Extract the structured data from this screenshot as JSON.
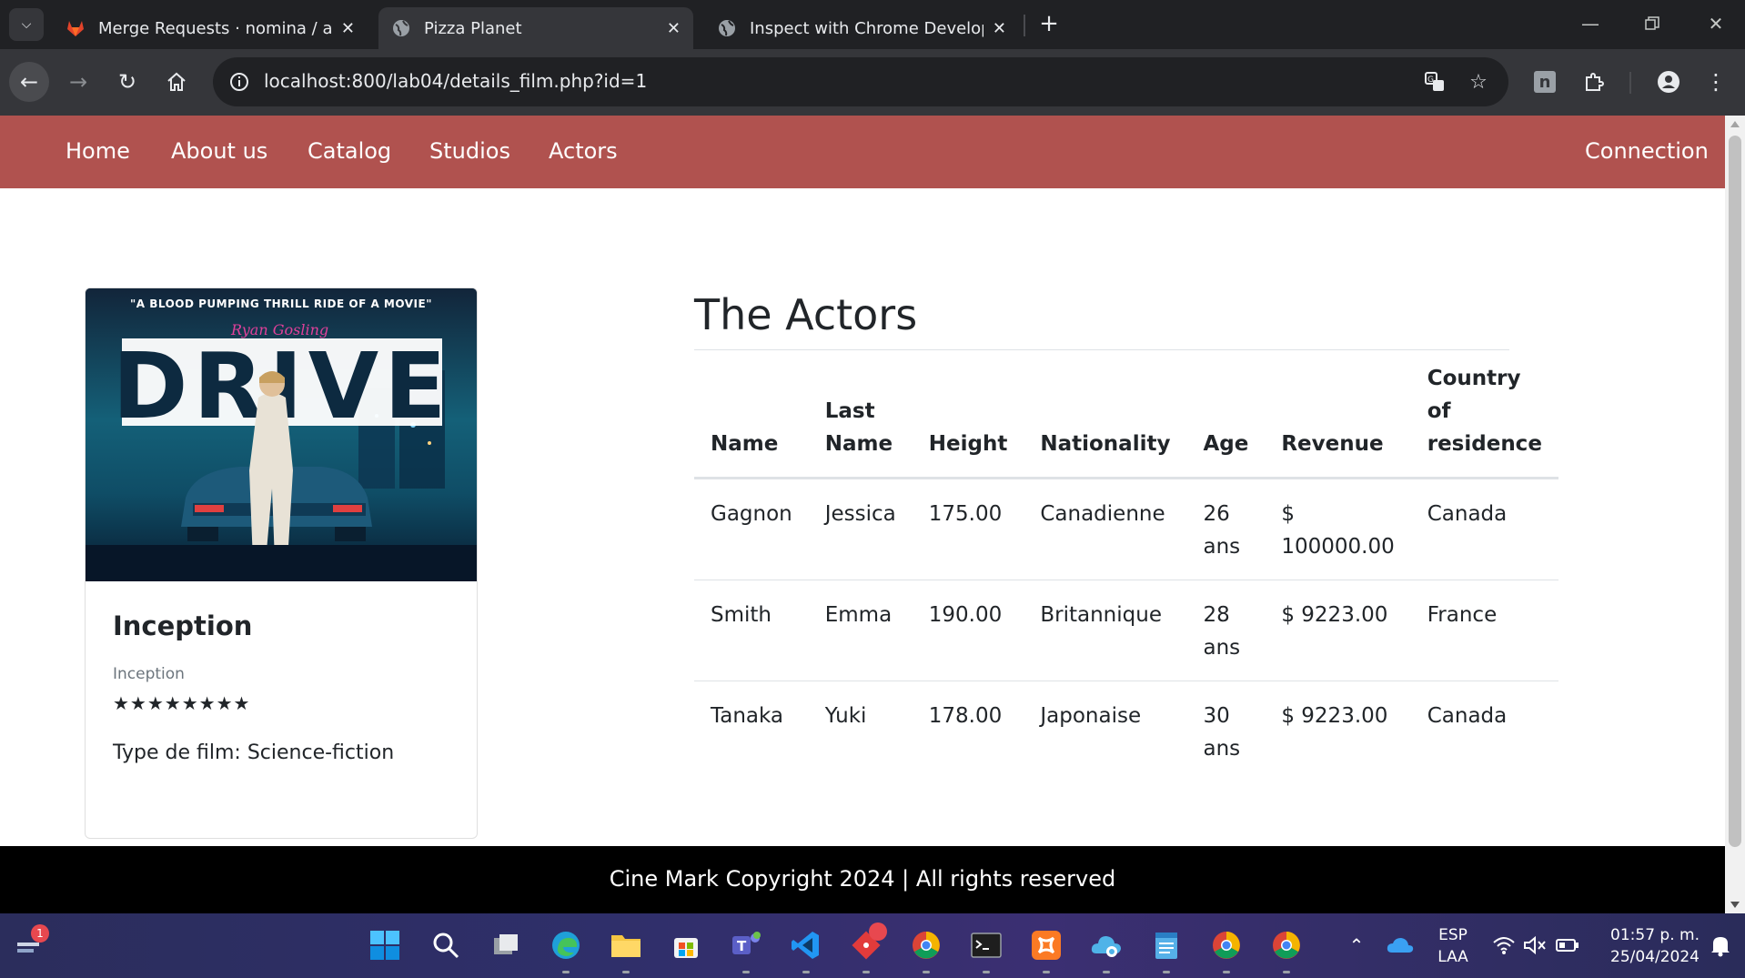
{
  "browser": {
    "tabs": [
      {
        "title": "Merge Requests · nomina / ang",
        "icon": "gitlab-icon",
        "active": false
      },
      {
        "title": "Pizza Planet",
        "icon": "globe-icon",
        "active": true
      },
      {
        "title": "Inspect with Chrome Developer",
        "icon": "globe-icon",
        "active": false
      }
    ],
    "url": "localhost:800/lab04/details_film.php?id=1",
    "new_tab": "+"
  },
  "site": {
    "nav": {
      "home": "Home",
      "about": "About us",
      "catalog": "Catalog",
      "studios": "Studios",
      "actors": "Actors",
      "connection": "Connection"
    },
    "film_card": {
      "poster": {
        "tagline": "\"A BLOOD PUMPING THRILL RIDE OF A MOVIE\"",
        "actor": "Ryan Gosling",
        "title": "DRIVE"
      },
      "title": "Inception",
      "subtitle": "Inception",
      "stars": "★★★★★★★★",
      "rating": 8,
      "type": "Type de film: Science-fiction"
    },
    "actors_section": {
      "heading": "The Actors",
      "headers": {
        "name": "Name",
        "last_name": [
          "Last",
          "Name"
        ],
        "height": "Height",
        "nationality": "Nationality",
        "age": "Age",
        "revenue": "Revenue",
        "country": [
          "Country",
          "of",
          "residence"
        ]
      },
      "rows": [
        {
          "name": "Gagnon",
          "last_name": "Jessica",
          "height": "175.00",
          "nationality": "Canadienne",
          "age": [
            "26",
            "ans"
          ],
          "revenue": [
            "$",
            "100000.00"
          ],
          "country": "Canada"
        },
        {
          "name": "Smith",
          "last_name": "Emma",
          "height": "190.00",
          "nationality": "Britannique",
          "age": [
            "28",
            "ans"
          ],
          "revenue": [
            "$ 9223.00"
          ],
          "country": "France"
        },
        {
          "name": "Tanaka",
          "last_name": "Yuki",
          "height": "178.00",
          "nationality": "Japonaise",
          "age": [
            "30",
            "ans"
          ],
          "revenue": [
            "$ 9223.00"
          ],
          "country": "Canada"
        }
      ]
    },
    "footer": "Cine Mark Copyright 2024 | All rights reserved"
  },
  "taskbar": {
    "notification_badge": "1",
    "lang_line1": "ESP",
    "lang_line2": "LAA",
    "time": "01:57 p. m.",
    "date": "25/04/2024"
  },
  "colors": {
    "navbar": "#b0524f",
    "footer": "#000000",
    "chrome_dark": "#202124",
    "chrome_toolbar": "#35363a"
  }
}
